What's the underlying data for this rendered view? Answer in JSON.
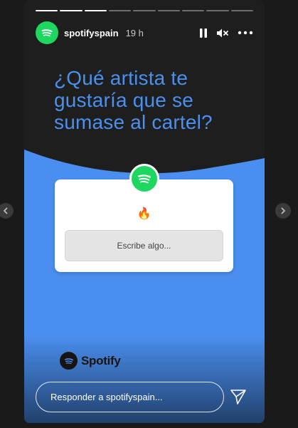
{
  "story": {
    "username": "spotifyspain",
    "time_ago": "19 h",
    "progress": {
      "segments": 9,
      "completed": 3
    },
    "question": "¿Qué artista te gustaría que se sumase al cartel?",
    "card": {
      "emoji": "🔥",
      "answer_placeholder": "Escribe algo..."
    },
    "brand": {
      "name": "Spotify"
    },
    "reply": {
      "placeholder": "Responder a spotifyspain..."
    }
  },
  "colors": {
    "spotify_green": "#1ed760",
    "question_blue": "#4a90ee",
    "background_blue": "#4a8ff0"
  },
  "icons": {
    "pause": "pause-icon",
    "mute": "mute-icon",
    "more": "more-options-icon",
    "send": "send-icon",
    "prev": "chevron-left-icon",
    "next": "chevron-right-icon"
  }
}
